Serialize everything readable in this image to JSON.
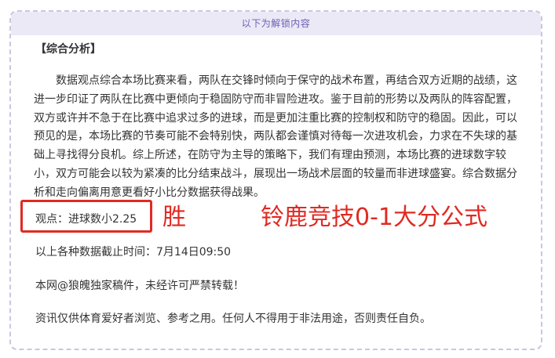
{
  "header": {
    "unlock_label": "以下为解锁内容"
  },
  "article": {
    "section_title": "【综合分析】",
    "analysis_paragraph": "数据观点综合本场比赛来看，两队在交锋时倾向于保守的战术布置，再结合双方近期的战绩，这进一步印证了两队在比赛中更倾向于稳固防守而非冒险进攻。鉴于目前的形势以及两队的阵容配置，双方或许并不急于在比赛中追求过多的进球，而是更加注重比赛的控制权和防守的稳固。因此，可以预见的是，本场比赛的节奏可能不会特别快，两队都会谨慎对待每一次进攻机会，力求在不失球的基础上寻找得分良机。综上所述，在防守为主导的策略下，我们有理由预测，本场比赛的进球数字较小，双方可能会以较为紧凑的比分结束战斗，展现出一场战术层面的较量而非进球盛宴。综合数据分析和走向偏离用意更看好小比分数据获得战果。",
    "viewpoint": "观点：进球数小2.25",
    "data_cutoff": "以上各种数据截止时间：7月14日09:50",
    "copyright": "本网@狼魄独家稿件，未经许可严禁转载！",
    "disclaimer": "资讯仅供体育爱好者浏览、参考之用。任何人不得用于非法用途，否则责任自负。"
  },
  "overlay": {
    "result": "胜",
    "formula": "铃鹿竞技0-1大分公式"
  },
  "colors": {
    "accent_red": "#e02a22",
    "header_bg": "#ebe9f6",
    "header_text": "#6b5fb5",
    "border": "#c9c6e0"
  }
}
